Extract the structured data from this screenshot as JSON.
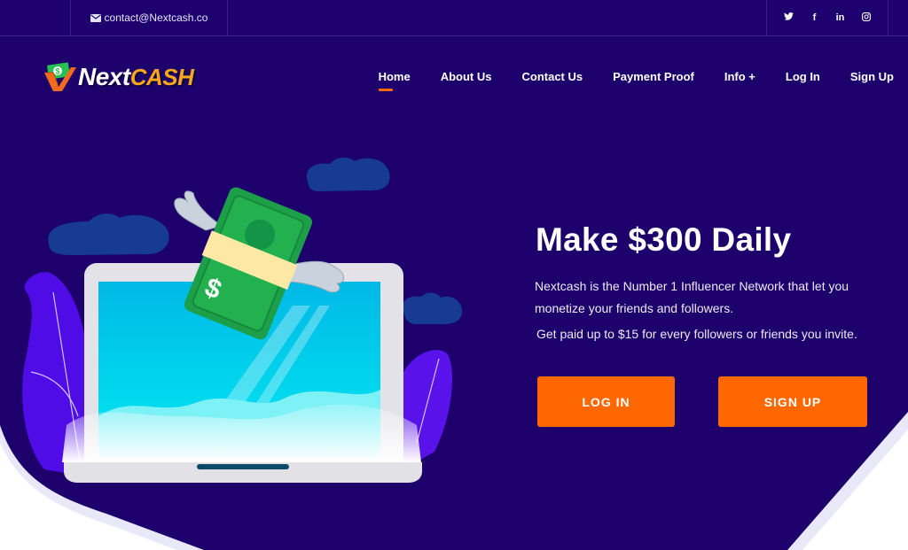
{
  "topbar": {
    "email": "contact@Nextcash.co",
    "email_icon": "envelope-icon",
    "social": [
      {
        "name": "twitter-icon",
        "glyph": "🐦"
      },
      {
        "name": "facebook-icon",
        "glyph": "f"
      },
      {
        "name": "linkedin-icon",
        "glyph": "in"
      },
      {
        "name": "instagram-icon",
        "glyph": "◎"
      }
    ]
  },
  "logo": {
    "text_primary": "Next",
    "text_secondary": "CASH"
  },
  "nav": {
    "items": [
      {
        "label": "Home",
        "active": true
      },
      {
        "label": "About Us"
      },
      {
        "label": "Contact Us"
      },
      {
        "label": "Payment Proof"
      },
      {
        "label": "Info +"
      },
      {
        "label": "Log In"
      },
      {
        "label": "Sign Up"
      }
    ]
  },
  "hero": {
    "title": "Make $300 Daily",
    "description": "Nextcash is the Number 1 Influencer Network that let you monetize your friends and followers.",
    "subdescription": "Get paid up to $15 for every followers or friends you invite.",
    "login_label": "LOG IN",
    "signup_label": "SIGN UP"
  },
  "colors": {
    "background": "#1d006b",
    "accent": "#ff6700",
    "logo_cash": "#f8a61a"
  }
}
